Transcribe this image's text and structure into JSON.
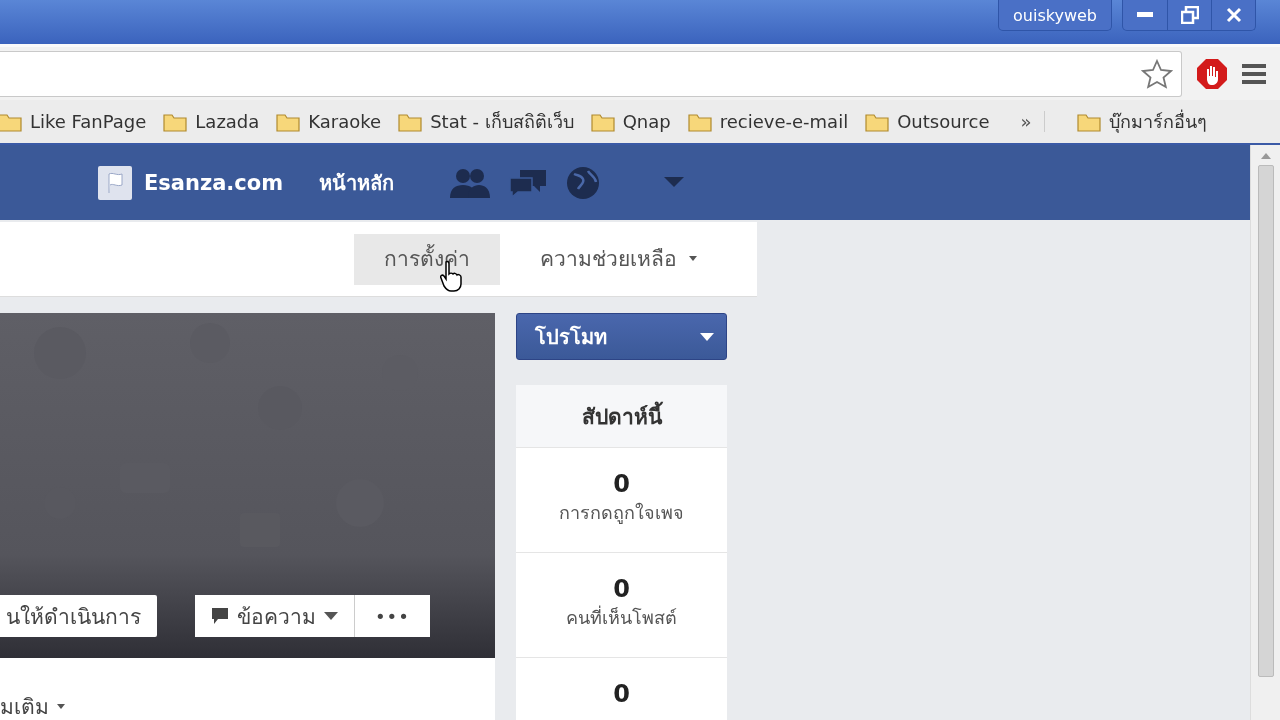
{
  "window": {
    "user": "ouiskyweb"
  },
  "bookmarks": {
    "items": [
      {
        "label": "Like FanPage"
      },
      {
        "label": "Lazada"
      },
      {
        "label": "Karaoke"
      },
      {
        "label": "Stat - เก็บสถิติเว็บ"
      },
      {
        "label": "Qnap"
      },
      {
        "label": "recieve-e-mail"
      },
      {
        "label": "Outsource"
      }
    ],
    "overflow": "»",
    "other": "บุ๊กมาร์กอื่นๆ"
  },
  "page_header": {
    "page_name": "Esanza.com",
    "home": "หน้าหลัก"
  },
  "page_tabs": [
    {
      "label": "การตั้งค่า",
      "selected": true,
      "dropdown": false
    },
    {
      "label": "ความช่วยเหลือ",
      "selected": false,
      "dropdown": true
    }
  ],
  "cover": {
    "buttons": [
      {
        "label": "นให้ดำเนินการ",
        "kind": "plain"
      },
      {
        "label": "ข้อความ",
        "kind": "message"
      },
      {
        "label": "•••",
        "kind": "more"
      }
    ]
  },
  "more_link": "มเติม",
  "promote": {
    "label": "โปรโมท"
  },
  "stats": {
    "title": "สัปดาห์นี้",
    "items": [
      {
        "value": "0",
        "label": "การกดถูกใจเพจ"
      },
      {
        "value": "0",
        "label": "คนที่เห็นโพสต์"
      },
      {
        "value": "0"
      }
    ]
  }
}
